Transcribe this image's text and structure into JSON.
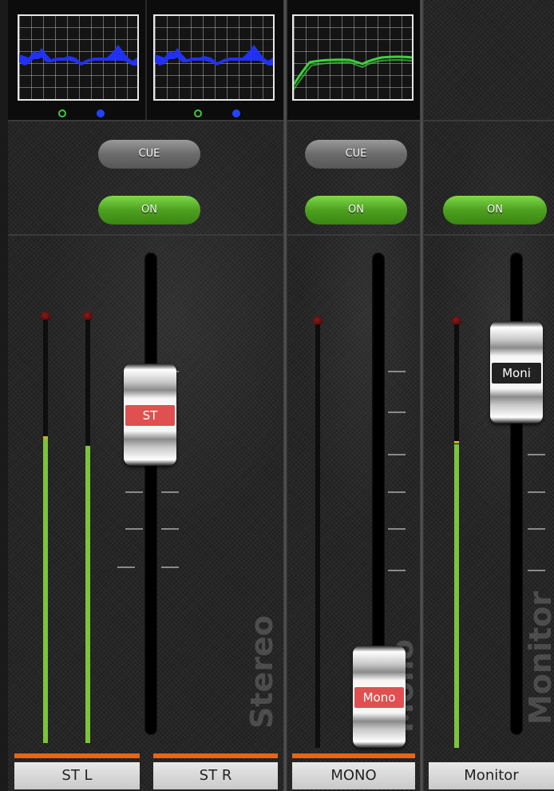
{
  "channels": [
    {
      "id": "stereo",
      "title": "Stereo",
      "cue_label": "CUE",
      "on_label": "ON",
      "knob_label": "ST",
      "name_left": "ST L",
      "name_right": "ST R",
      "knob_color": "#e05050"
    },
    {
      "id": "mono",
      "title": "Mono",
      "cue_label": "CUE",
      "on_label": "ON",
      "knob_label": "Mono",
      "name": "MONO",
      "knob_color": "#e05050"
    },
    {
      "id": "monitor",
      "title": "Monitor",
      "on_label": "ON",
      "knob_label": "Moni",
      "name": "Monitor",
      "knob_color": "#222222"
    }
  ],
  "eq_icons": [
    "eq-on-icon",
    "eq-hpf-icon"
  ],
  "colors": {
    "on": "#4da01f",
    "cue": "#6b6b6b",
    "accent": "#e5661a",
    "meter": "#7bc43c",
    "eq_curve_blue": "#2233ff",
    "eq_curve_green": "#3cd23c"
  }
}
